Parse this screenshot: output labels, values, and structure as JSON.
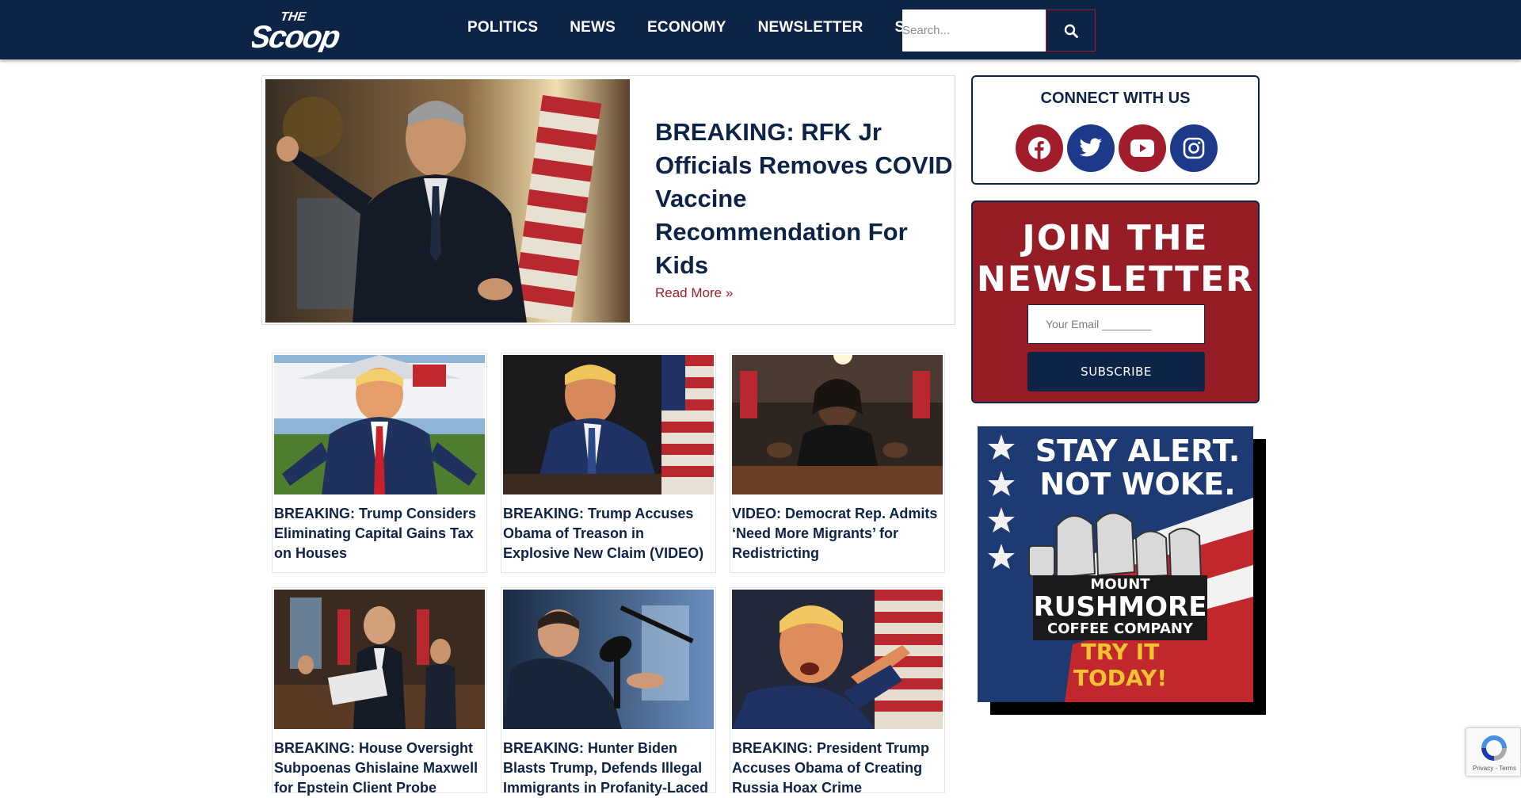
{
  "header": {
    "logo_text": "THE SCOOP",
    "nav": [
      "POLITICS",
      "NEWS",
      "ECONOMY",
      "NEWSLETTER",
      "STO"
    ],
    "search_placeholder": "Search..."
  },
  "hero": {
    "title": "BREAKING: RFK Jr Officials Removes COVID Vaccine Recommendation For Kids",
    "read_more": "Read More »"
  },
  "cards": [
    {
      "title": "BREAKING: Trump Considers Eliminating Capital Gains Tax on Houses"
    },
    {
      "title": "BREAKING: Trump Accuses Obama of Treason in Explosive New Claim (VIDEO)"
    },
    {
      "title": "VIDEO: Democrat Rep. Admits ‘Need More Migrants’ for Redistricting"
    },
    {
      "title": "BREAKING: House Oversight Subpoenas Ghislaine Maxwell for Epstein Client Probe"
    },
    {
      "title": "BREAKING: Hunter Biden Blasts Trump, Defends Illegal Immigrants in Profanity-Laced"
    },
    {
      "title": "BREAKING: President Trump Accuses Obama of Creating Russia Hoax Crime"
    }
  ],
  "sidebar": {
    "connect_title": "CONNECT WITH US",
    "social": [
      {
        "icon": "facebook-icon",
        "color": "#a11d2b"
      },
      {
        "icon": "twitter-icon",
        "color": "#1d3a8a"
      },
      {
        "icon": "youtube-icon",
        "color": "#a11d2b"
      },
      {
        "icon": "instagram-icon",
        "color": "#1d3a8a"
      }
    ],
    "newsletter_title_line1": "JOIN THE",
    "newsletter_title_line2": "NEWSLETTER",
    "email_placeholder": "Your Email ________",
    "subscribe_label": "SUBSCRIBE"
  },
  "ad": {
    "line1": "STAY ALERT.",
    "line2": "NOT WOKE.",
    "brand_top": "MOUNT",
    "brand_main": "RUSHMORE",
    "brand_sub": "COFFEE COMPANY",
    "cta": "TRY IT TODAY!"
  },
  "recaptcha": {
    "links": "Privacy - Terms"
  },
  "colors": {
    "navy": "#0d2447",
    "crimson": "#961c26",
    "accent_red": "#a11d2b",
    "gold": "#f2c230"
  }
}
